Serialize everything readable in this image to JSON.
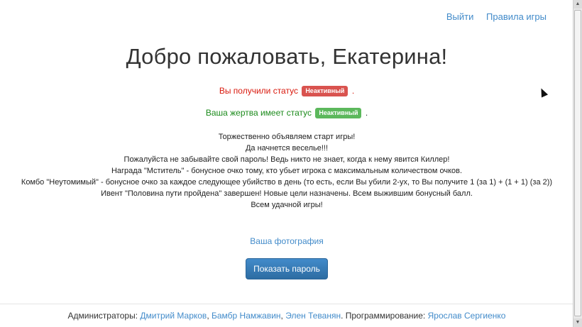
{
  "nav": {
    "logout": "Выйти",
    "rules": "Правила игры"
  },
  "title": "Добро пожаловать, Екатерина!",
  "status": {
    "own_text": "Вы получили статус",
    "own_badge": "Неактивный",
    "victim_text": "Ваша жертва имеет статус",
    "victim_badge": "Неактивный",
    "dot": ".",
    "colors": {
      "own_text": "#d9190d",
      "own_badge": "#d9534f",
      "victim_text": "#1b8a1b",
      "victim_badge": "#5cb85c"
    }
  },
  "announcement": [
    "Торжественно объявляем старт игры!",
    "Да начнется веселье!!!",
    "Пожалуйста не забывайте свой пароль! Ведь никто не знает, когда к нему явится Киллер!",
    "Награда \"Мститель\" - бонусное очко тому, кто убьет игрока с максимальным количеством очков.",
    "Комбо \"Неутомимый\" - бонусное очко за каждое следующее убийство в день (то есть, если Вы убили 2-ух, то Вы получите 1 (за 1) + (1 + 1) (за 2))",
    "Ивент \"Половина пути пройдена\" завершен! Новые цели назначены. Всем выжившим бонусный балл.",
    "Всем удачной игры!"
  ],
  "photo_link": "Ваша фотография",
  "show_password_button": "Показать пароль",
  "footer": {
    "admins_label": "Администраторы:",
    "admins": [
      "Дмитрий Марков",
      "Бамбр Намжавин",
      "Элен Теванян"
    ],
    "sep": ",",
    "programming_label": ". Программирование:",
    "programmer": "Ярослав Сергиенко"
  },
  "accent_color": "#428bca"
}
